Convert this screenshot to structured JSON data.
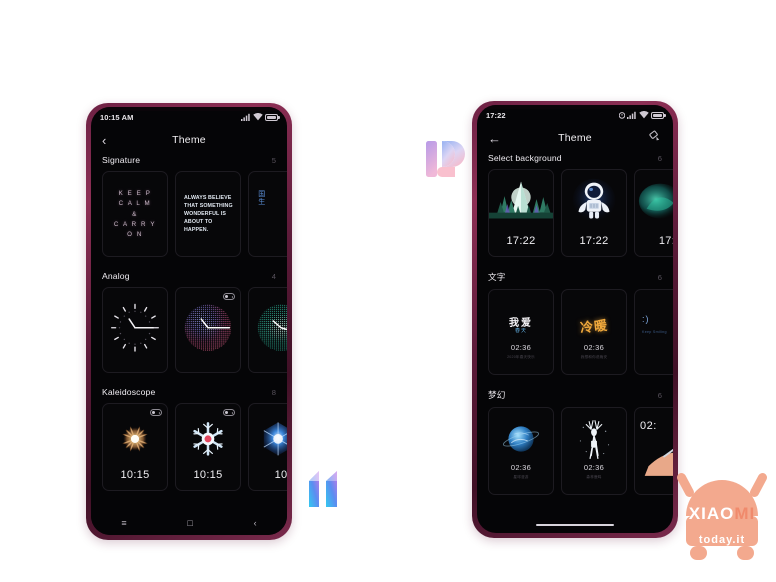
{
  "page": {
    "background": "#ffffff",
    "phone_frame_color": "#7a2a4c",
    "screen_background": "#050507"
  },
  "left_phone": {
    "status_bar": {
      "time": "10:15 AM",
      "icons": [
        "signal-icon",
        "wifi-icon",
        "battery-icon"
      ]
    },
    "app_bar": {
      "back_label": "‹",
      "title": "Theme"
    },
    "sections": [
      {
        "title": "Signature",
        "count": "5",
        "cards": [
          {
            "type": "quote-keep-calm",
            "lines": [
              "K E E P",
              "C A L M",
              "&",
              "C A R R Y",
              "O N"
            ],
            "always_on": false
          },
          {
            "type": "quote-believe",
            "text": "ALWAYS BELIEVE THAT SOMETHING WONDERFUL IS ABOUT TO HAPPEN.",
            "always_on": false
          },
          {
            "type": "quote-cn",
            "text": "国生",
            "always_on": false
          }
        ]
      },
      {
        "title": "Analog",
        "count": "4",
        "cards": [
          {
            "type": "analog-clock-classic",
            "always_on": false
          },
          {
            "type": "analog-clock-dots-color",
            "always_on": true
          },
          {
            "type": "analog-clock-dots-teal",
            "always_on": false
          }
        ]
      },
      {
        "title": "Kaleidoscope",
        "count": "8",
        "cards": [
          {
            "type": "kaleidoscope-gold",
            "time": "10:15",
            "always_on": true
          },
          {
            "type": "kaleidoscope-snowflake",
            "time": "10:15",
            "always_on": true
          },
          {
            "type": "kaleidoscope-blue",
            "time": "10",
            "always_on": false
          }
        ]
      }
    ],
    "nav_bar": {
      "type": "three-button",
      "menu": "≡",
      "home": "□",
      "back": "‹"
    }
  },
  "right_phone": {
    "status_bar": {
      "time": "17:22",
      "icons": [
        "alarm-icon",
        "signal-icon",
        "wifi-icon",
        "battery-icon"
      ]
    },
    "app_bar": {
      "back_label": "←",
      "title": "Theme",
      "action_icon": "paint-roller-icon"
    },
    "sections": [
      {
        "title": "Select background",
        "count": "6",
        "cards": [
          {
            "type": "bg-mountain-forest",
            "time": "17:22"
          },
          {
            "type": "bg-astronaut",
            "time": "17:22"
          },
          {
            "type": "bg-teal-abstract",
            "time": "17:"
          }
        ]
      },
      {
        "title": "文字",
        "count": "6",
        "cards": [
          {
            "type": "text-cn-white",
            "headline": "我爱",
            "subline": "春天",
            "time": "02:36",
            "footer": "2020年春天快乐"
          },
          {
            "type": "text-cn-gold",
            "headline": "冷暖",
            "time": "02:36",
            "footer": "我想和你说晚安"
          },
          {
            "type": "text-smiley",
            "headline": ":)",
            "footer": "Keep Smiling"
          }
        ]
      },
      {
        "title": "梦幻",
        "count": "6",
        "cards": [
          {
            "type": "dream-planet",
            "time": "02:36",
            "footer": "星球漫游"
          },
          {
            "type": "dream-deer",
            "time": "02:36",
            "footer": "森林鹿鸣"
          },
          {
            "type": "dream-hand",
            "time": "02:"
          }
        ]
      }
    ],
    "nav_bar": {
      "type": "gesture-pill"
    }
  },
  "branding": {
    "miui12_logo": "miui-12-logo",
    "miui11_logo": "miui-11-logo",
    "watermark": {
      "line1_prefix": "XIAO",
      "line1_suffix": "MI",
      "line2": "today.it",
      "accent": "#f08a6c"
    }
  }
}
